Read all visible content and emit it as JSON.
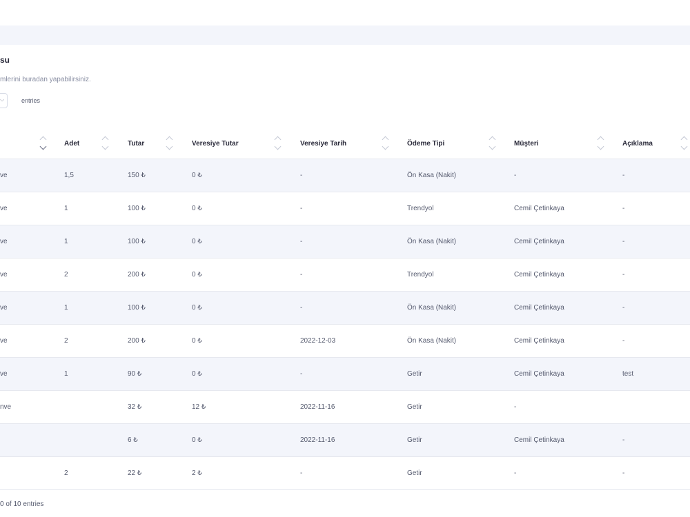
{
  "header": {
    "title": "su",
    "subtitle": "mlerini buradan yapabilirsiniz."
  },
  "length_menu": {
    "label": "entries",
    "chevron": "chevron-down-icon"
  },
  "table": {
    "columns": [
      "Adet",
      "Tutar",
      "Veresiye Tutar",
      "Veresiye Tarih",
      "Ödeme Tipi",
      "Müşteri",
      "Açıklama"
    ],
    "rows": [
      [
        "ve",
        "1,5",
        "150 ₺",
        "0 ₺",
        "-",
        "Ön Kasa (Nakit)",
        "-",
        "-"
      ],
      [
        "ve",
        "1",
        "100 ₺",
        "0 ₺",
        "-",
        "Trendyol",
        "Cemil Çetinkaya",
        "-"
      ],
      [
        "ve",
        "1",
        "100 ₺",
        "0 ₺",
        "-",
        "Ön Kasa (Nakit)",
        "Cemil Çetinkaya",
        "-"
      ],
      [
        "ve",
        "2",
        "200 ₺",
        "0 ₺",
        "-",
        "Trendyol",
        "Cemil Çetinkaya",
        "-"
      ],
      [
        "ve",
        "1",
        "100 ₺",
        "0 ₺",
        "-",
        "Ön Kasa (Nakit)",
        "Cemil Çetinkaya",
        "-"
      ],
      [
        "ve",
        "2",
        "200 ₺",
        "0 ₺",
        "2022-12-03",
        "Ön Kasa (Nakit)",
        "Cemil Çetinkaya",
        "-"
      ],
      [
        "ve",
        "1",
        "90 ₺",
        "0 ₺",
        "-",
        "Getir",
        "Cemil Çetinkaya",
        "test"
      ],
      [
        "nve",
        "",
        "32 ₺",
        "12 ₺",
        "2022-11-16",
        "Getir",
        "-",
        ""
      ],
      [
        "",
        "",
        "6 ₺",
        "0 ₺",
        "2022-11-16",
        "Getir",
        "Cemil Çetinkaya",
        "-"
      ],
      [
        "",
        "2",
        "22 ₺",
        "2 ₺",
        "-",
        "Getir",
        "-",
        "-"
      ]
    ]
  },
  "footer": {
    "info": "0 of 10 entries"
  },
  "colors": {
    "accent_band": "#f3f5fb",
    "text": "#555a6e",
    "header_text": "#2b2b3b",
    "border": "#e6e8ef"
  }
}
